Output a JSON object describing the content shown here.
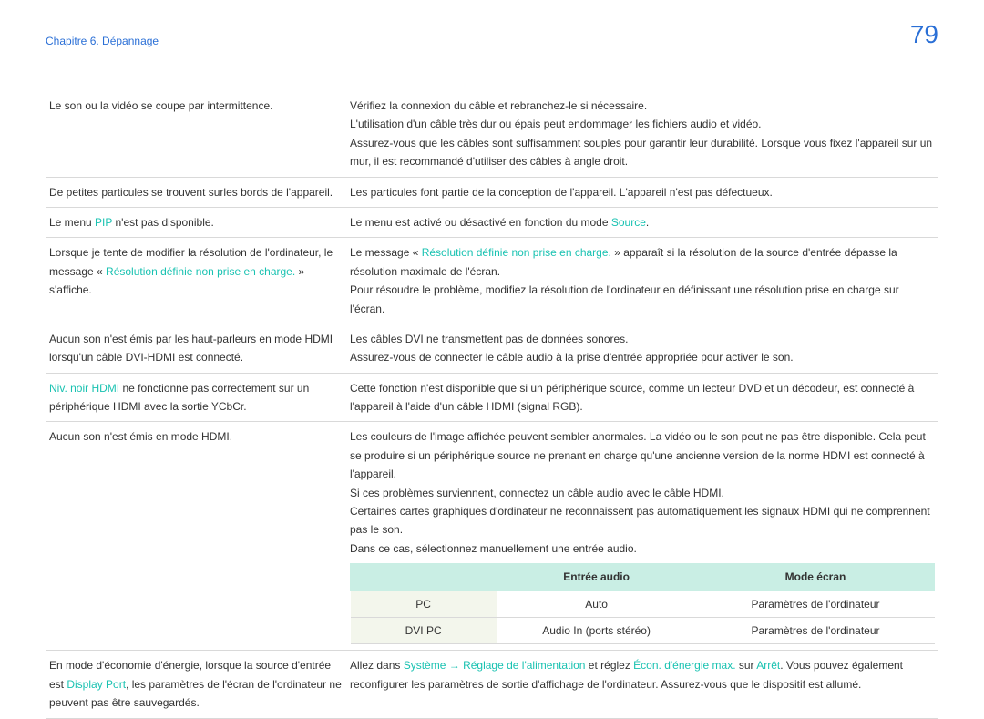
{
  "chapter": "Chapitre 6. Dépannage",
  "page_number": "79",
  "rows": [
    {
      "left": {
        "parts": [
          {
            "t": "Le son ou la vidéo se coupe par intermittence."
          }
        ]
      },
      "right": {
        "paras": [
          [
            {
              "t": "Vérifiez la connexion du câble et rebranchez-le si nécessaire."
            }
          ],
          [
            {
              "t": "L'utilisation d'un câble très dur ou épais peut endommager les fichiers audio et vidéo."
            }
          ],
          [
            {
              "t": "Assurez-vous que les câbles sont suffisamment souples pour garantir leur durabilité. Lorsque vous fixez l'appareil sur un mur, il est recommandé d'utiliser des câbles à angle droit."
            }
          ]
        ]
      }
    },
    {
      "left": {
        "parts": [
          {
            "t": "De petites particules se trouvent surles bords de l'appareil."
          }
        ]
      },
      "right": {
        "paras": [
          [
            {
              "t": "Les particules font partie de la conception de l'appareil. L'appareil n'est pas défectueux."
            }
          ]
        ]
      }
    },
    {
      "left": {
        "parts": [
          {
            "t": "Le menu "
          },
          {
            "t": "PIP",
            "hl": true
          },
          {
            "t": " n'est pas disponible."
          }
        ]
      },
      "right": {
        "paras": [
          [
            {
              "t": "Le menu est activé ou désactivé en fonction du mode "
            },
            {
              "t": "Source",
              "hl": true
            },
            {
              "t": "."
            }
          ]
        ]
      }
    },
    {
      "left": {
        "parts": [
          {
            "t": "Lorsque je tente de modifier la résolution de l'ordinateur, le message « "
          },
          {
            "t": "Résolution définie non prise en charge.",
            "hl": true
          },
          {
            "t": " » s'affiche."
          }
        ]
      },
      "right": {
        "paras": [
          [
            {
              "t": "Le message « "
            },
            {
              "t": "Résolution définie non prise en charge.",
              "hl": true
            },
            {
              "t": " » apparaît si la résolution de la source d'entrée dépasse la résolution maximale de l'écran."
            }
          ],
          [
            {
              "t": "Pour résoudre le problème, modifiez la résolution de l'ordinateur en définissant une résolution prise en charge sur l'écran."
            }
          ]
        ]
      }
    },
    {
      "left": {
        "parts": [
          {
            "t": "Aucun son n'est émis par les haut-parleurs en mode HDMI lorsqu'un câble DVI-HDMI est connecté."
          }
        ]
      },
      "right": {
        "paras": [
          [
            {
              "t": "Les câbles DVI ne transmettent pas de données sonores."
            }
          ],
          [
            {
              "t": "Assurez-vous de connecter le câble audio à la prise d'entrée appropriée pour activer le son."
            }
          ]
        ]
      }
    },
    {
      "left": {
        "parts": [
          {
            "t": "Niv. noir HDMI",
            "hl": true
          },
          {
            "t": " ne fonctionne pas correctement sur un périphérique HDMI avec la sortie YCbCr."
          }
        ]
      },
      "right": {
        "paras": [
          [
            {
              "t": "Cette fonction n'est disponible que si un périphérique source, comme un lecteur DVD et un décodeur, est connecté à l'appareil à l'aide d'un câble HDMI (signal RGB)."
            }
          ]
        ]
      }
    },
    {
      "left": {
        "parts": [
          {
            "t": "Aucun son n'est émis en mode HDMI."
          }
        ]
      },
      "right": {
        "paras": [
          [
            {
              "t": "Les couleurs de l'image affichée peuvent sembler anormales. La vidéo ou le son peut ne pas être disponible. Cela peut se produire si un périphérique source ne prenant en charge qu'une ancienne version de la norme HDMI est connecté à l'appareil."
            }
          ],
          [
            {
              "t": "Si ces problèmes surviennent, connectez un câble audio avec le câble HDMI."
            }
          ],
          [
            {
              "t": "Certaines cartes graphiques d'ordinateur ne reconnaissent pas automatiquement les signaux HDMI qui ne comprennent pas le son."
            }
          ],
          [
            {
              "t": "Dans ce cas, sélectionnez manuellement une entrée audio."
            }
          ]
        ],
        "inner_table": {
          "headers": [
            "",
            "Entrée audio",
            "Mode écran"
          ],
          "rows": [
            [
              "PC",
              "Auto",
              "Paramètres de l'ordinateur"
            ],
            [
              "DVI PC",
              "Audio In (ports stéréo)",
              "Paramètres de l'ordinateur"
            ]
          ]
        }
      }
    },
    {
      "left": {
        "parts": [
          {
            "t": "En mode d'économie d'énergie, lorsque la source d'entrée est "
          },
          {
            "t": "Display Port",
            "hl": true
          },
          {
            "t": ", les paramètres de l'écran de l'ordinateur ne peuvent pas être sauvegardés."
          }
        ]
      },
      "right": {
        "paras": [
          [
            {
              "t": "Allez dans "
            },
            {
              "t": "Système",
              "hl": true
            },
            {
              "t": " "
            },
            {
              "t": "→",
              "arrow": true
            },
            {
              "t": " "
            },
            {
              "t": "Réglage de l'alimentation",
              "hl": true
            },
            {
              "t": " et réglez "
            },
            {
              "t": "Écon. d'énergie max.",
              "hl": true
            },
            {
              "t": " sur "
            },
            {
              "t": "Arrêt",
              "hl": true
            },
            {
              "t": ". Vous pouvez également reconfigurer les paramètres de sortie d'affichage de l'ordinateur. Assurez-vous que le dispositif est allumé."
            }
          ]
        ]
      }
    }
  ]
}
